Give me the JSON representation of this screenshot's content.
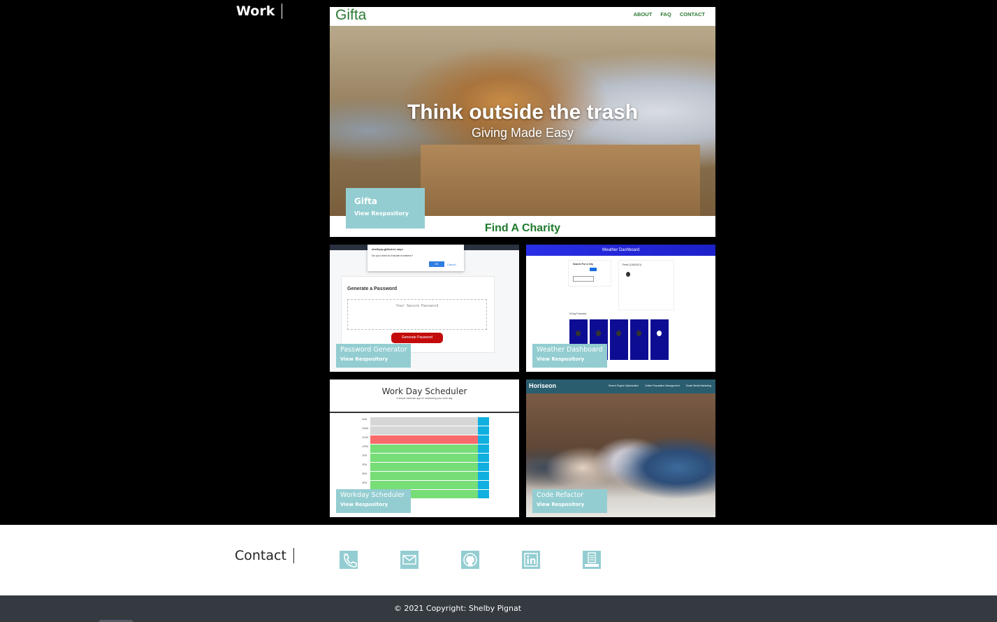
{
  "work": {
    "title": "Work",
    "projects": [
      {
        "name": "Gifta",
        "repo_label": "View Respository",
        "preview": {
          "logo": "Gifta",
          "nav": [
            "ABOUT",
            "FAQ",
            "CONTACT"
          ],
          "hero_title": "Think outside the trash",
          "hero_subtitle": "Giving Made Easy",
          "bottom_heading": "Find A Charity"
        }
      },
      {
        "name": "Password Generator",
        "repo_label": "View Respository",
        "preview": {
          "alert_title": "shelbyrp.github.io says",
          "alert_text": "Do you wish to include numbers?",
          "alert_ok": "OK",
          "alert_cancel": "Cancel",
          "panel_title": "Generate a Password",
          "placeholder": "Your Secure Password",
          "button": "Generate Password"
        }
      },
      {
        "name": "Weather Dashboard",
        "repo_label": "View Respository",
        "preview": {
          "header": "Weather Dashboard",
          "search_label": "Search For A City",
          "current_city": "Perth (12/6/2021)",
          "forecast_label": "5-Day Forecast"
        }
      },
      {
        "name": "Workday Scheduler",
        "repo_label": "View Respository",
        "preview": {
          "title": "Work Day Scheduler",
          "subtitle": "A simple calendar app for scheduling your work day",
          "hours": [
            "9AM",
            "10AM",
            "11AM",
            "12PM",
            "1PM",
            "2PM",
            "3PM",
            "4PM",
            "5PM"
          ]
        }
      },
      {
        "name": "Code Refactor",
        "repo_label": "View Respository",
        "preview": {
          "logo": "Horiseon",
          "nav": [
            "Search Engine Optimization",
            "Online Reputation Management",
            "Social Media Marketing"
          ]
        }
      }
    ]
  },
  "contact": {
    "title": "Contact",
    "icons": [
      "phone-icon",
      "email-icon",
      "github-icon",
      "linkedin-icon",
      "resume-icon"
    ],
    "icon_color": "#93cdd1"
  },
  "footer": {
    "text": "© 2021 Copyright: Shelby Pignat"
  },
  "colors": {
    "caption_bg": "#93cdd1",
    "footer_bg": "#343a40",
    "work_bg": "#000000"
  }
}
